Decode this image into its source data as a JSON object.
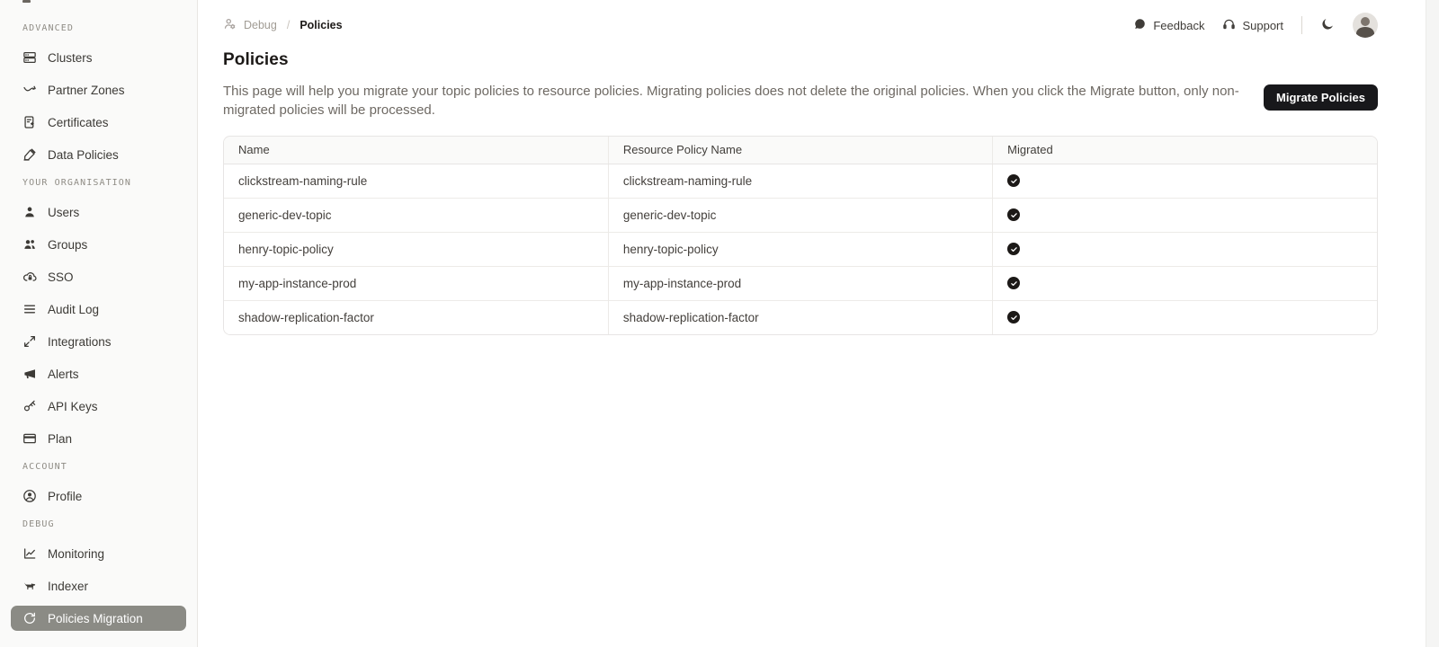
{
  "sidebar": {
    "sections": [
      {
        "label": "ADVANCED",
        "items": [
          {
            "label": "Clusters",
            "icon": "clusters-icon"
          },
          {
            "label": "Partner Zones",
            "icon": "partner-zones-icon"
          },
          {
            "label": "Certificates",
            "icon": "certificates-icon"
          },
          {
            "label": "Data Policies",
            "icon": "data-policies-icon"
          }
        ]
      },
      {
        "label": "YOUR ORGANISATION",
        "items": [
          {
            "label": "Users",
            "icon": "users-icon"
          },
          {
            "label": "Groups",
            "icon": "groups-icon"
          },
          {
            "label": "SSO",
            "icon": "sso-icon"
          },
          {
            "label": "Audit Log",
            "icon": "audit-log-icon"
          },
          {
            "label": "Integrations",
            "icon": "integrations-icon"
          },
          {
            "label": "Alerts",
            "icon": "alerts-icon"
          },
          {
            "label": "API Keys",
            "icon": "api-keys-icon"
          },
          {
            "label": "Plan",
            "icon": "plan-icon"
          }
        ]
      },
      {
        "label": "ACCOUNT",
        "items": [
          {
            "label": "Profile",
            "icon": "profile-icon"
          }
        ]
      },
      {
        "label": "DEBUG",
        "items": [
          {
            "label": "Monitoring",
            "icon": "monitoring-icon"
          },
          {
            "label": "Indexer",
            "icon": "indexer-icon"
          },
          {
            "label": "Policies Migration",
            "icon": "policies-migration-icon",
            "active": true
          }
        ]
      }
    ]
  },
  "topbar": {
    "breadcrumb": {
      "parent": "Debug",
      "separator": "/",
      "current": "Policies"
    },
    "feedback_label": "Feedback",
    "support_label": "Support"
  },
  "page": {
    "title": "Policies",
    "description": "This page will help you migrate your topic policies to resource policies. Migrating policies does not delete the original policies. When you click the Migrate button, only non-migrated policies will be processed.",
    "migrate_button_label": "Migrate Policies"
  },
  "table": {
    "columns": [
      "Name",
      "Resource Policy Name",
      "Migrated"
    ],
    "rows": [
      {
        "name": "clickstream-naming-rule",
        "resource_policy_name": "clickstream-naming-rule",
        "migrated": true
      },
      {
        "name": "generic-dev-topic",
        "resource_policy_name": "generic-dev-topic",
        "migrated": true
      },
      {
        "name": "henry-topic-policy",
        "resource_policy_name": "henry-topic-policy",
        "migrated": true
      },
      {
        "name": "my-app-instance-prod",
        "resource_policy_name": "my-app-instance-prod",
        "migrated": true
      },
      {
        "name": "shadow-replication-factor",
        "resource_policy_name": "shadow-replication-factor",
        "migrated": true
      }
    ]
  },
  "colors": {
    "accent_button": "#18181b",
    "selected_item_bg": "#8b8b85",
    "check_badge": "#1c1917",
    "sidebar_bg": "#fafaf9",
    "border": "#e7e5e4"
  }
}
